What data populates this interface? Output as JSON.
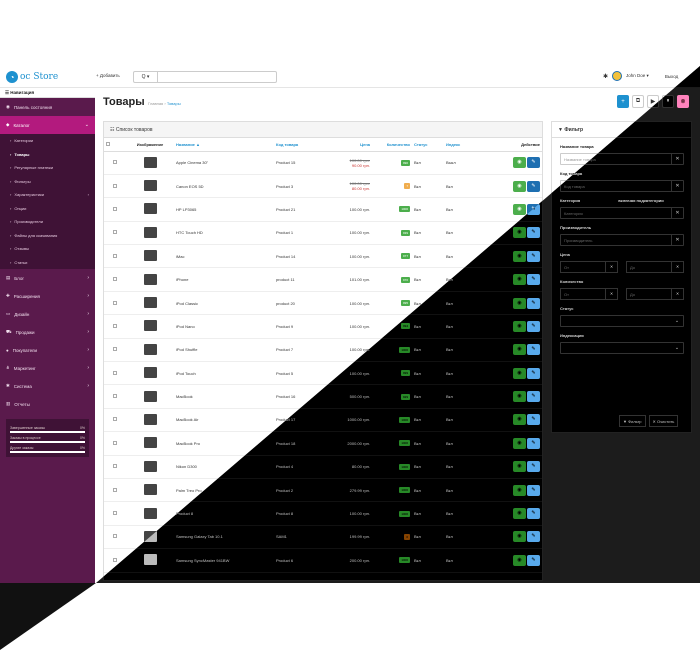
{
  "header": {
    "logo_text": "oc Store",
    "add_label": "+ Добавить",
    "search_select": "Q ▾",
    "search_value": "",
    "user_name": "John Doe ▾",
    "logout": "Выход"
  },
  "sidebar": {
    "title": "☰ Навигация",
    "items": [
      {
        "label": "Панель состояния",
        "icon": "dashboard-icon"
      },
      {
        "label": "Каталог",
        "icon": "tag-icon"
      },
      {
        "label": "Блог",
        "icon": "blog-icon"
      },
      {
        "label": "Расширения",
        "icon": "puzzle-icon"
      },
      {
        "label": "Дизайн",
        "icon": "monitor-icon"
      },
      {
        "label": "Продажи",
        "icon": "cart-icon"
      },
      {
        "label": "Покупатели",
        "icon": "user-icon"
      },
      {
        "label": "Маркетинг",
        "icon": "share-icon"
      },
      {
        "label": "Система",
        "icon": "gear-icon"
      },
      {
        "label": "Отчеты",
        "icon": "chart-icon"
      }
    ],
    "subitems": [
      "Категории",
      "Товары",
      "Регулярные платежи",
      "Фильтры",
      "Характеристики",
      "Опции",
      "Производители",
      "Файлы для скачивания",
      "Отзывы",
      "Статьи"
    ],
    "stats": [
      {
        "label": "Завершенные заказы",
        "value": "0%"
      },
      {
        "label": "Заказы в процессе",
        "value": "0%"
      },
      {
        "label": "Другие заказы",
        "value": "0%"
      }
    ]
  },
  "page": {
    "title": "Товары",
    "crumb_home": "Главная",
    "crumb_sep": "›",
    "crumb_current": "Товары"
  },
  "list": {
    "title": "☷ Список товаров",
    "columns": {
      "image": "Изображение",
      "name": "Название ▲",
      "model": "Код товара",
      "price": "Цена",
      "quantity": "Количество",
      "status": "Статус",
      "index": "Индекс",
      "action": "Действие"
    },
    "rows": [
      {
        "name": "Apple Cinema 30\"",
        "model": "Product 15",
        "price_old": "100.00 грн.",
        "price_new": "90.00 грн.",
        "qty": "990",
        "status": "Вкл",
        "index": "Выкл"
      },
      {
        "name": "Canon EOS 5D",
        "model": "Product 3",
        "price_old": "100.00 грн.",
        "price_new": "80.00 грн.",
        "qty": "7",
        "status": "Вкл",
        "index": "Вкл"
      },
      {
        "name": "HP LP3065",
        "model": "Product 21",
        "price": "100.00 грн.",
        "qty": "1000",
        "status": "Вкл",
        "index": "Вкл"
      },
      {
        "name": "HTC Touch HD",
        "model": "Product 1",
        "price": "100.00 грн.",
        "qty": "939",
        "status": "Вкл",
        "index": "Вкл"
      },
      {
        "name": "iMac",
        "model": "Product 14",
        "price": "100.00 грн.",
        "qty": "977",
        "status": "Вкл",
        "index": "Вкл"
      },
      {
        "name": "iPhone",
        "model": "product 11",
        "price": "101.00 грн.",
        "qty": "970",
        "status": "Вкл",
        "index": "Вкл"
      },
      {
        "name": "iPod Classic",
        "model": "product 20",
        "price": "100.00 грн.",
        "qty": "995",
        "status": "Вкл",
        "index": "Вкл"
      },
      {
        "name": "iPod Nano",
        "model": "Product 9",
        "price": "100.00 грн.",
        "qty": "994",
        "status": "Вкл",
        "index": "Вкл"
      },
      {
        "name": "iPod Shuffle",
        "model": "Product 7",
        "price": "100.00 грн.",
        "qty": "1000",
        "status": "Вкл",
        "index": "Вкл"
      },
      {
        "name": "iPod Touch",
        "model": "Product 5",
        "price": "100.00 грн.",
        "qty": "999",
        "status": "Вкл",
        "index": "Вкл"
      },
      {
        "name": "MacBook",
        "model": "Product 16",
        "price": "500.00 грн.",
        "qty": "929",
        "status": "Вкл",
        "index": "Вкл"
      },
      {
        "name": "MacBook Air",
        "model": "Product 17",
        "price": "1000.00 грн.",
        "qty": "1000",
        "status": "Вкл",
        "index": "Вкл"
      },
      {
        "name": "MacBook Pro",
        "model": "Product 18",
        "price": "2000.00 грн.",
        "qty": "1000",
        "status": "Вкл",
        "index": "Вкл"
      },
      {
        "name": "Nikon D300",
        "model": "Product 4",
        "price": "80.00 грн.",
        "qty": "1000",
        "status": "Вкл",
        "index": "Вкл"
      },
      {
        "name": "Palm Treo Pro",
        "model": "Product 2",
        "price": "279.99 грн.",
        "qty": "1000",
        "status": "Вкл",
        "index": "Вкл"
      },
      {
        "name": "Product 8",
        "model": "Product 8",
        "price": "100.00 грн.",
        "qty": "1000",
        "status": "Вкл",
        "index": "Вкл"
      },
      {
        "name": "Samsung Galaxy Tab 10.1",
        "model": "SAM1",
        "price": "199.99 грн.",
        "qty": "0",
        "status": "Вкл",
        "index": "Вкл"
      },
      {
        "name": "Samsung SyncMaster 941BW",
        "model": "Product 6",
        "price": "200.00 грн.",
        "qty": "1000",
        "status": "Вкл",
        "index": "Вкл"
      }
    ]
  },
  "filter": {
    "title": "Фильтр",
    "name_label": "Название товара",
    "name_placeholder": "Название товара",
    "model_label": "Код товара",
    "model_placeholder": "Код товара",
    "category_label": "Категория",
    "subcat_label": "включая подкатегории",
    "category_placeholder": "Категория",
    "manufacturer_label": "Производитель",
    "manufacturer_placeholder": "Производитель",
    "price_label": "Цена",
    "qty_label": "Количество",
    "from": "От",
    "to": "До",
    "status_label": "Статус",
    "index_label": "Индексация",
    "filter_btn": "▼ Фильтр",
    "clear_btn": "✕ Очистить"
  },
  "colors": {
    "sidebar_bg": "#5a1a4c",
    "sidebar_active": "#b31a7e",
    "accent": "#1e91cf",
    "green": "#4cae4c",
    "dark": "#1c1c1c"
  }
}
